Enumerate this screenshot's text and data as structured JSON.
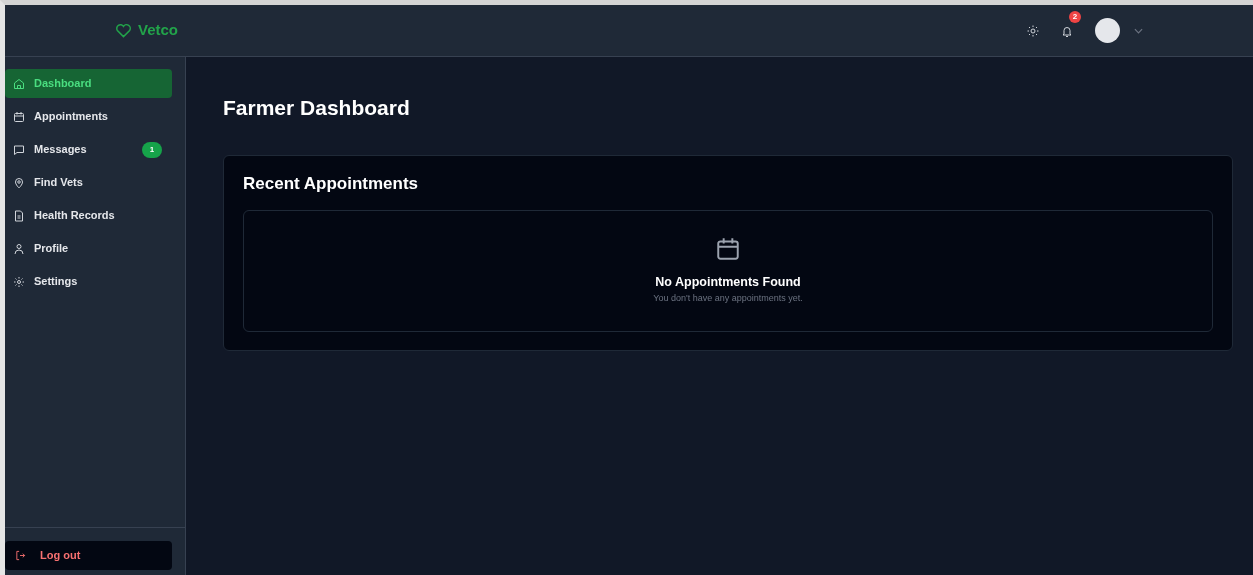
{
  "brand": {
    "name": "Vetco"
  },
  "header": {
    "notification_count": "2"
  },
  "sidebar": {
    "items": [
      {
        "kind": "home",
        "label": "Dashboard",
        "selected": true
      },
      {
        "kind": "calendar",
        "label": "Appointments",
        "selected": false
      },
      {
        "kind": "message",
        "label": "Messages",
        "selected": false,
        "badge": "1"
      },
      {
        "kind": "pin",
        "label": "Find Vets",
        "selected": false
      },
      {
        "kind": "document",
        "label": "Health Records",
        "selected": false
      },
      {
        "kind": "user",
        "label": "Profile",
        "selected": false
      },
      {
        "kind": "gear",
        "label": "Settings",
        "selected": false
      }
    ],
    "logout": "Log out"
  },
  "page": {
    "title": "Farmer Dashboard"
  },
  "card": {
    "title": "Recent Appointments",
    "empty_title": "No Appointments Found",
    "empty_text": "You don't have any appointments yet."
  }
}
